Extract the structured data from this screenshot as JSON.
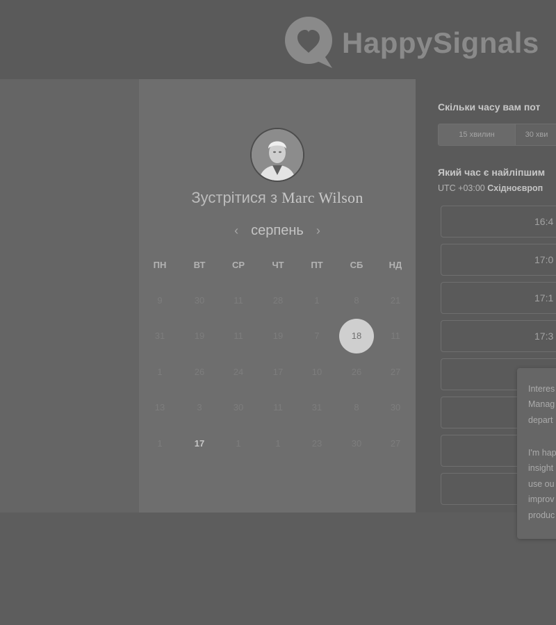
{
  "brand": {
    "name": "HappySignals"
  },
  "calendar": {
    "title_prefix": "Зустрітися з",
    "host_name": "Marc Wilson",
    "month": "серпень",
    "prev_icon": "chevron-left-icon",
    "next_icon": "chevron-right-icon",
    "weekdays": [
      "ПН",
      "ВТ",
      "СР",
      "ЧТ",
      "ПТ",
      "СБ",
      "НД"
    ],
    "weeks": [
      [
        "9",
        "30",
        "11",
        "28",
        "1",
        "8",
        "21"
      ],
      [
        "31",
        "19",
        "11",
        "19",
        "7",
        "18",
        "11"
      ],
      [
        "1",
        "26",
        "24",
        "17",
        "10",
        "26",
        "27"
      ],
      [
        "13",
        "3",
        "30",
        "11",
        "31",
        "8",
        "30"
      ],
      [
        "1",
        "17",
        "1",
        "1",
        "23",
        "30",
        "27"
      ]
    ],
    "selected_day": "18",
    "highlight_day": "17"
  },
  "booking": {
    "duration_question": "Скільки часу вам пот",
    "durations": [
      "15 хвилин",
      "30 хви"
    ],
    "active_duration": "15 хвилин",
    "time_question": "Який час є найліпшим",
    "timezone_prefix": "UTC +03:00",
    "timezone_name": "Східноєвроп",
    "slots": [
      "16:4",
      "17:0",
      "17:1",
      "17:3",
      "",
      "",
      "",
      ""
    ]
  },
  "chat": {
    "lines": [
      "Interes",
      "Manag",
      "depart",
      "",
      "I'm hap",
      "insight",
      "use ou",
      "improv",
      "produc"
    ]
  }
}
